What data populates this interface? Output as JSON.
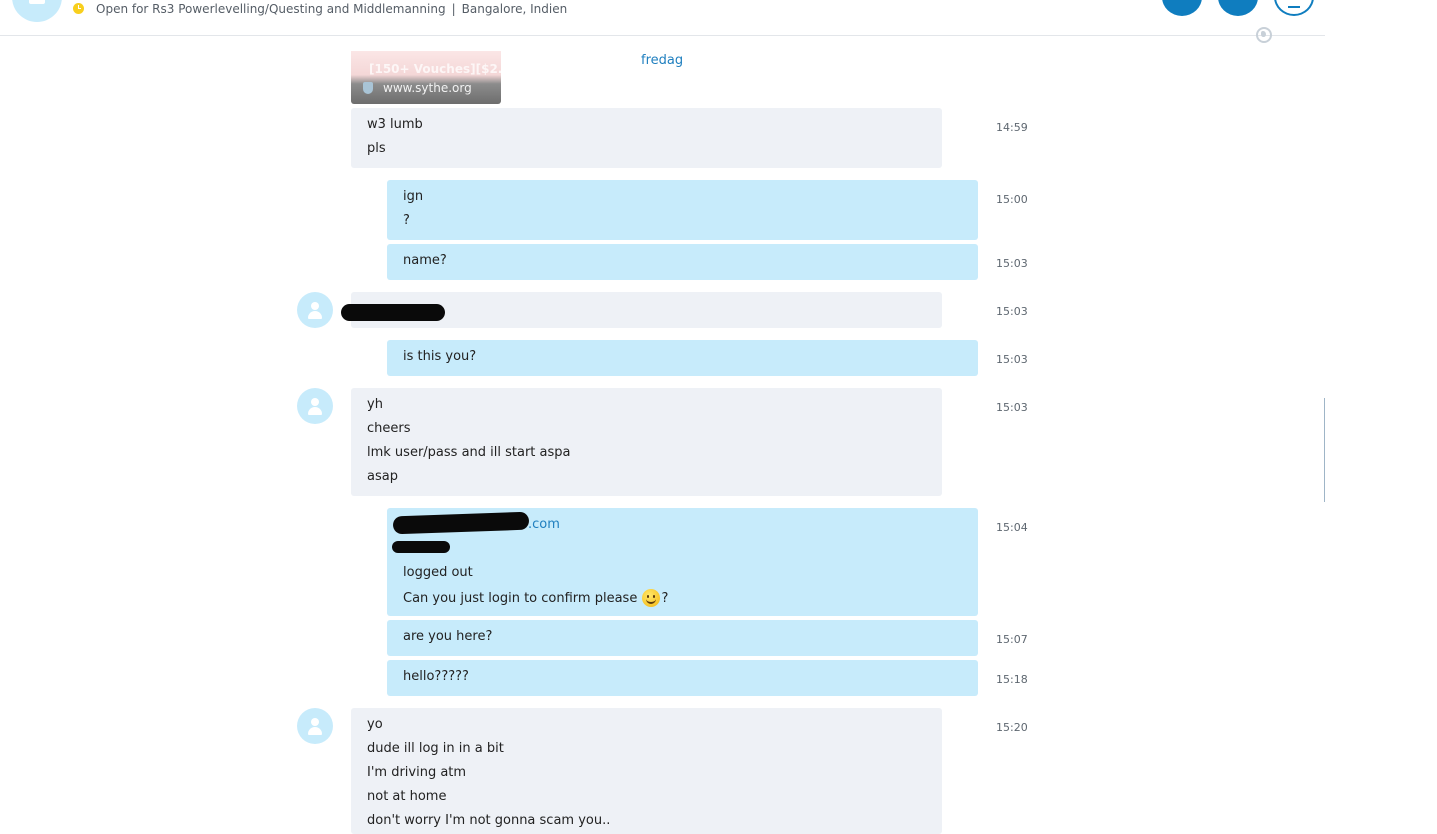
{
  "header": {
    "mood_message": "Open for Rs3 Powerlevelling/Questing and Middlemanning",
    "separator": "|",
    "location": "Bangalore, Indien"
  },
  "conversation": {
    "link_preview": {
      "title": "[150+ Vouches][$2...",
      "domain": "www.sythe.org"
    },
    "date_divider": "fredag",
    "messages": [
      {
        "direction": "incoming",
        "time": "14:59",
        "lines": [
          "w3 lumb",
          "pls"
        ]
      },
      {
        "direction": "outgoing",
        "time": "15:00",
        "lines": [
          "ign",
          "?"
        ]
      },
      {
        "direction": "outgoing",
        "time": "15:03",
        "lines": [
          "name?"
        ]
      },
      {
        "direction": "incoming",
        "time": "15:03",
        "lines": [],
        "redacted": true
      },
      {
        "direction": "outgoing",
        "time": "15:03",
        "lines": [
          "is this you?"
        ]
      },
      {
        "direction": "incoming",
        "time": "15:03",
        "lines": [
          "yh",
          "cheers",
          "lmk user/pass and ill start aspa",
          "asap"
        ]
      },
      {
        "direction": "outgoing",
        "time": "15:04",
        "link_suffix": ".com",
        "lines": [
          "logged out",
          "Can you just login to confirm please",
          "?"
        ]
      },
      {
        "direction": "outgoing",
        "time": "15:07",
        "lines": [
          "are you here?"
        ]
      },
      {
        "direction": "outgoing",
        "time": "15:18",
        "lines": [
          "hello?????"
        ]
      },
      {
        "direction": "incoming",
        "time": "15:20",
        "lines": [
          "yo",
          "dude ill log in in a bit",
          "I'm driving atm",
          "not at home",
          "don't worry I'm not gonna scam you.."
        ]
      }
    ]
  }
}
